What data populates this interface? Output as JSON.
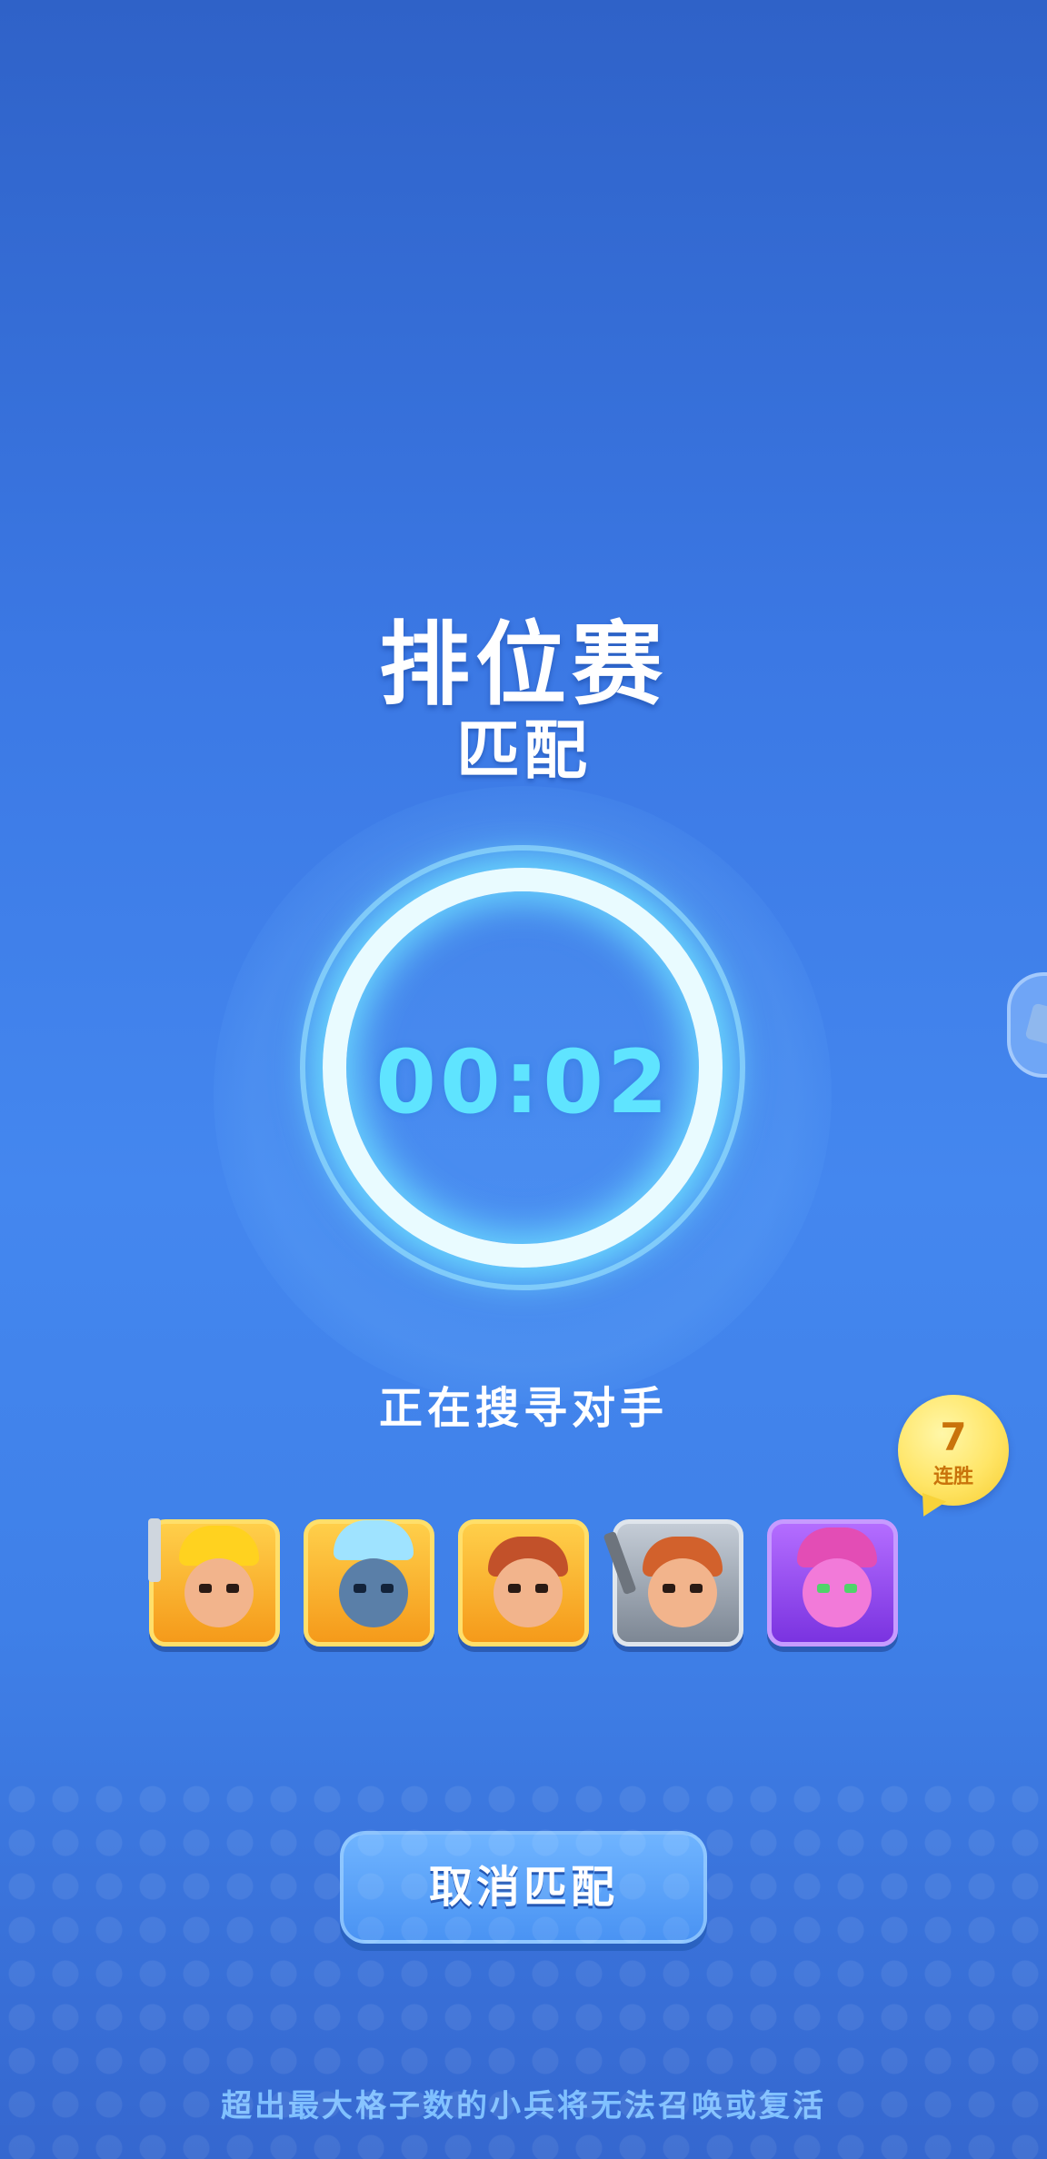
{
  "header": {
    "title": "排位赛",
    "subtitle": "匹配"
  },
  "matchmaking": {
    "timer": "00:02",
    "status": "正在搜寻对手"
  },
  "streak": {
    "count": "7",
    "label": "连胜"
  },
  "heroes": [
    {
      "name": "king-warrior",
      "frame": "gold"
    },
    {
      "name": "ice-golem",
      "frame": "gold"
    },
    {
      "name": "red-hair-fighter",
      "frame": "gold"
    },
    {
      "name": "sword-barbarian",
      "frame": "grey"
    },
    {
      "name": "pink-ogre",
      "frame": "purple"
    }
  ],
  "actions": {
    "cancel_label": "取消匹配"
  },
  "footer": {
    "hint": "超出最大格子数的小兵将无法召唤或复活"
  },
  "colors": {
    "background": "#3b78e4",
    "timer": "#5fe4ff",
    "ring": "#e9fbff",
    "button": "#4a93f3",
    "streak_badge": "#ffe566",
    "hint_text": "#7fc0ff"
  }
}
